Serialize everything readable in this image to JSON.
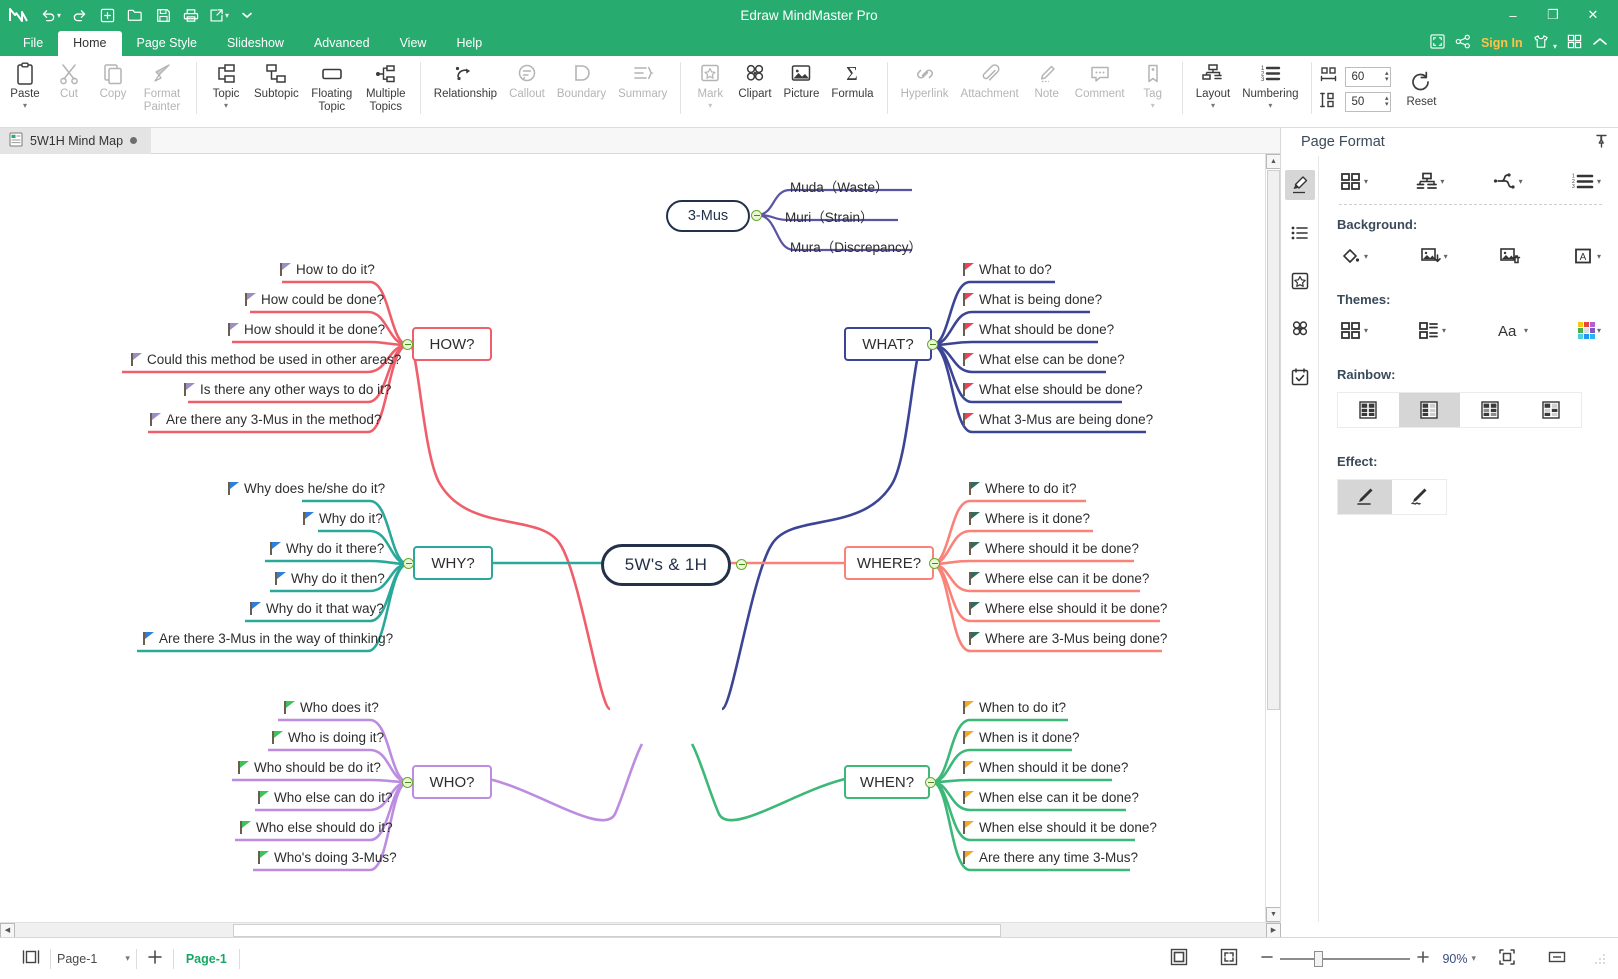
{
  "app": {
    "title": "Edraw MindMaster Pro",
    "logo_icon": "mindmaster-logo-icon"
  },
  "quick_access": [
    {
      "name": "undo",
      "icon": "undo-icon",
      "has_caret": true
    },
    {
      "name": "redo",
      "icon": "redo-icon",
      "has_caret": false
    },
    {
      "name": "new",
      "icon": "new-file-icon",
      "has_caret": false
    },
    {
      "name": "open",
      "icon": "open-folder-icon",
      "has_caret": false
    },
    {
      "name": "save",
      "icon": "save-disk-icon",
      "has_caret": false
    },
    {
      "name": "print",
      "icon": "printer-icon",
      "has_caret": false
    },
    {
      "name": "export-share",
      "icon": "export-icon",
      "has_caret": true
    },
    {
      "name": "customize-qat",
      "icon": "chevron-down-icon",
      "has_caret": false
    }
  ],
  "window_buttons": {
    "minimize": "–",
    "maximize": "❐",
    "close": "✕"
  },
  "menu": {
    "items": [
      {
        "label": "File",
        "active": false
      },
      {
        "label": "Home",
        "active": true
      },
      {
        "label": "Page Style",
        "active": false
      },
      {
        "label": "Slideshow",
        "active": false
      },
      {
        "label": "Advanced",
        "active": false
      },
      {
        "label": "View",
        "active": false
      },
      {
        "label": "Help",
        "active": false
      }
    ],
    "right": {
      "fullscreen_icon": "fullscreen-icon",
      "share_icon": "share-nodes-icon",
      "sign_in_label": "Sign In",
      "theme_icon": "tshirt-theme-icon",
      "apps_icon": "grid-apps-icon",
      "collapse_ribbon_icon": "chevron-up-icon"
    }
  },
  "ribbon": {
    "groups": [
      {
        "name": "clipboard",
        "items": [
          {
            "label": "Paste",
            "icon": "clipboard-icon",
            "disabled": false,
            "dropdown": true
          },
          {
            "label": "Cut",
            "icon": "scissors-icon",
            "disabled": true,
            "dropdown": false
          },
          {
            "label": "Copy",
            "icon": "copy-icon",
            "disabled": true,
            "dropdown": false
          },
          {
            "label": "Format Painter",
            "icon": "format-painter-icon",
            "disabled": true,
            "dropdown": false
          }
        ]
      },
      {
        "name": "topics",
        "items": [
          {
            "label": "Topic",
            "icon": "topic-icon",
            "disabled": false,
            "dropdown": true
          },
          {
            "label": "Subtopic",
            "icon": "subtopic-icon",
            "disabled": false,
            "dropdown": false
          },
          {
            "label": "Floating Topic",
            "icon": "floating-topic-icon",
            "disabled": false,
            "dropdown": false
          },
          {
            "label": "Multiple Topics",
            "icon": "multiple-topics-icon",
            "disabled": false,
            "dropdown": false
          }
        ]
      },
      {
        "name": "annotations",
        "items": [
          {
            "label": "Relationship",
            "icon": "relationship-icon",
            "disabled": false,
            "dropdown": false
          },
          {
            "label": "Callout",
            "icon": "callout-icon",
            "disabled": true,
            "dropdown": false
          },
          {
            "label": "Boundary",
            "icon": "boundary-icon",
            "disabled": true,
            "dropdown": false
          },
          {
            "label": "Summary",
            "icon": "summary-icon",
            "disabled": true,
            "dropdown": false
          }
        ]
      },
      {
        "name": "insert",
        "items": [
          {
            "label": "Mark",
            "icon": "mark-icon",
            "disabled": true,
            "dropdown": true
          },
          {
            "label": "Clipart",
            "icon": "clipart-icon",
            "disabled": false,
            "dropdown": false
          },
          {
            "label": "Picture",
            "icon": "picture-icon",
            "disabled": false,
            "dropdown": false
          },
          {
            "label": "Formula",
            "icon": "formula-sigma-icon",
            "disabled": false,
            "dropdown": false
          }
        ]
      },
      {
        "name": "attach",
        "items": [
          {
            "label": "Hyperlink",
            "icon": "hyperlink-icon",
            "disabled": true,
            "dropdown": false
          },
          {
            "label": "Attachment",
            "icon": "paperclip-icon",
            "disabled": true,
            "dropdown": false
          },
          {
            "label": "Note",
            "icon": "note-pencil-icon",
            "disabled": true,
            "dropdown": false
          },
          {
            "label": "Comment",
            "icon": "comment-icon",
            "disabled": true,
            "dropdown": false
          },
          {
            "label": "Tag",
            "icon": "tag-icon",
            "disabled": true,
            "dropdown": true
          }
        ]
      },
      {
        "name": "layout",
        "items": [
          {
            "label": "Layout",
            "icon": "layout-icon",
            "disabled": false,
            "dropdown": true
          },
          {
            "label": "Numbering",
            "icon": "numbering-icon",
            "disabled": false,
            "dropdown": true
          }
        ]
      }
    ],
    "spacing": {
      "horizontal_icon": "horizontal-spacing-icon",
      "horizontal_value": "60",
      "vertical_icon": "vertical-spacing-icon",
      "vertical_value": "50",
      "reset_label": "Reset",
      "reset_icon": "reset-refresh-icon"
    }
  },
  "doc_tab": {
    "icon": "document-icon",
    "label": "5W1H Mind Map",
    "modified_dot": true
  },
  "panel": {
    "title": "Page Format",
    "pin_icon": "pin-icon",
    "tabs": [
      {
        "name": "page-format",
        "icon": "paint-bucket-tilt-icon",
        "active": true
      },
      {
        "name": "outline",
        "icon": "list-icon",
        "active": false
      },
      {
        "name": "marks",
        "icon": "star-badge-icon",
        "active": false
      },
      {
        "name": "clipart",
        "icon": "clover-icon",
        "active": false
      },
      {
        "name": "tasks",
        "icon": "calendar-check-icon",
        "active": false
      }
    ],
    "top_icons": [
      {
        "name": "theme-grid",
        "icon": "grid-4-icon"
      },
      {
        "name": "layout-structure",
        "icon": "hierarchy-icon"
      },
      {
        "name": "connector-style",
        "icon": "connector-icon"
      },
      {
        "name": "numbering-style",
        "icon": "numbering-list-icon"
      }
    ],
    "background": {
      "label": "Background:",
      "icons": [
        {
          "name": "fill-color",
          "icon": "paint-bucket-icon"
        },
        {
          "name": "insert-background-image",
          "icon": "image-insert-icon"
        },
        {
          "name": "remove-background-image",
          "icon": "image-delete-icon"
        },
        {
          "name": "watermark",
          "icon": "watermark-a-icon"
        }
      ]
    },
    "themes": {
      "label": "Themes:",
      "icons": [
        {
          "name": "theme-gallery",
          "icon": "grid-4-icon"
        },
        {
          "name": "theme-style",
          "icon": "grid-list-icon"
        },
        {
          "name": "theme-font",
          "icon": "font-aa-icon"
        },
        {
          "name": "theme-colors",
          "icon": "color-palette-icon"
        }
      ]
    },
    "rainbow": {
      "label": "Rainbow:",
      "options": [
        {
          "name": "rainbow-none",
          "active": false
        },
        {
          "name": "rainbow-light",
          "active": true
        },
        {
          "name": "rainbow-medium",
          "active": false
        },
        {
          "name": "rainbow-dark",
          "active": false
        }
      ]
    },
    "effect": {
      "label": "Effect:",
      "options": [
        {
          "name": "effect-straight",
          "icon": "pencil-straight-icon",
          "active": true
        },
        {
          "name": "effect-hand-drawn",
          "icon": "pencil-wavy-icon",
          "active": false
        }
      ]
    }
  },
  "status_bar": {
    "view_icon": "page-view-icon",
    "page_selector": "Page-1",
    "page_selector_caret": "▾",
    "add_page_icon": "plus-icon",
    "active_page": "Page-1",
    "fit_page_icon": "fit-page-icon",
    "fit_screen_icon": "fit-screen-icon",
    "zoom_out_icon": "minus-icon",
    "zoom_in_icon": "plus-icon",
    "zoom_level": "90%",
    "zoom_caret": "▾",
    "center_icon": "center-page-icon",
    "fit_width_icon": "fit-width-icon"
  },
  "mindmap": {
    "central": {
      "label": "5W's & 1H",
      "border_color": "#23304a"
    },
    "floating": {
      "label": "3-Mus",
      "border_color": "#23304a",
      "line_color": "#5a55a3",
      "children": [
        "Muda（Waste）",
        "Muri（Strain）",
        "Mura（Discrepancy）"
      ]
    },
    "branches": [
      {
        "label": "HOW?",
        "branch_color": "#ef5f6b",
        "flag_color": "#9b8ec4",
        "side": "left",
        "children": [
          "How to do it?",
          "How could be done?",
          "How should it be done?",
          "Could this method be used in other areas?",
          "Is there any other ways to do it?",
          "Are there any 3-Mus in the method?"
        ]
      },
      {
        "label": "WHAT?",
        "branch_color": "#3c4595",
        "flag_color": "#ef4058",
        "side": "right",
        "children": [
          "What to do?",
          "What is being done?",
          "What should be done?",
          "What else can be done?",
          "What else should be done?",
          "What 3-Mus are being done?"
        ]
      },
      {
        "label": "WHY?",
        "branch_color": "#2aa99a",
        "flag_color": "#2f7ed8",
        "side": "left",
        "children": [
          "Why does he/she do it?",
          "Why do it?",
          "Why do it there?",
          "Why do it then?",
          "Why do it that way?",
          "Are there 3-Mus in the way of thinking?"
        ]
      },
      {
        "label": "WHERE?",
        "branch_color": "#f98279",
        "flag_color": "#2f6b5e",
        "side": "right",
        "children": [
          "Where to do it?",
          "Where is it done?",
          "Where should it be done?",
          "Where  else can it be done?",
          "Where  else should it be done?",
          "Where are 3-Mus being done?"
        ]
      },
      {
        "label": "WHO?",
        "branch_color": "#bb8ce0",
        "flag_color": "#3cc35a",
        "side": "left",
        "children": [
          "Who does it?",
          "Who is doing it?",
          "Who should be do it?",
          "Who else can do it?",
          "Who else should do it?",
          "Who's doing 3-Mus?"
        ]
      },
      {
        "label": "WHEN?",
        "branch_color": "#3cb878",
        "flag_color": "#f5a623",
        "side": "right",
        "children": [
          "When to do it?",
          "When is it done?",
          "When should it be done?",
          "When else can it be done?",
          "When  else should it be done?",
          "Are there any time 3-Mus?"
        ]
      }
    ]
  }
}
